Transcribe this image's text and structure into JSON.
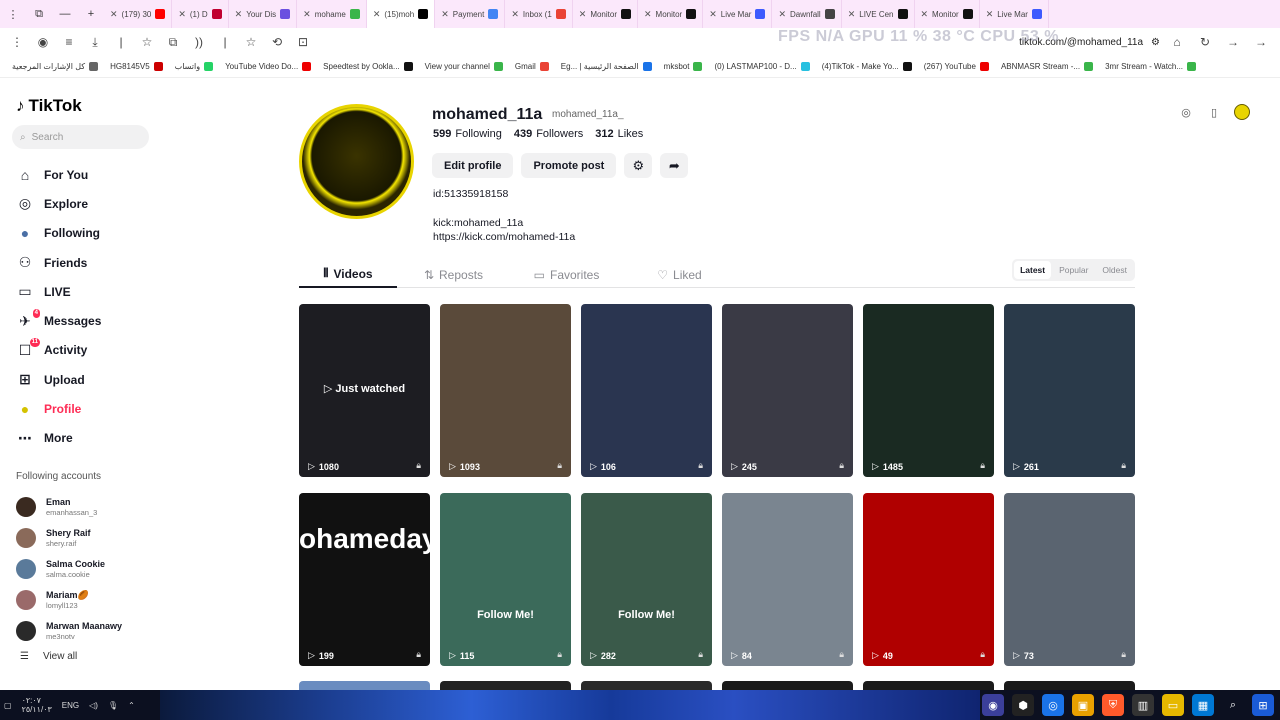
{
  "browser": {
    "tabs": [
      {
        "label": "(179) 30",
        "active": false,
        "fav_color": "#ff0000"
      },
      {
        "label": "(1) D",
        "active": false,
        "fav_color": "#c00030"
      },
      {
        "label": "Your Dis",
        "active": false,
        "fav_color": "#6b4fe0"
      },
      {
        "label": "mohame",
        "active": false,
        "fav_color": "#3ab54a"
      },
      {
        "label": "(15)moh",
        "active": true,
        "fav_color": "#000000"
      },
      {
        "label": "Payment",
        "active": false,
        "fav_color": "#4285f4"
      },
      {
        "label": "Inbox (1",
        "active": false,
        "fav_color": "#ea4335"
      },
      {
        "label": "Monitor",
        "active": false,
        "fav_color": "#111111"
      },
      {
        "label": "Monitor",
        "active": false,
        "fav_color": "#111111"
      },
      {
        "label": "Live Mar",
        "active": false,
        "fav_color": "#3d5afe"
      },
      {
        "label": "Dawnfall",
        "active": false,
        "fav_color": "#444444"
      },
      {
        "label": "LIVE Cen",
        "active": false,
        "fav_color": "#111111"
      },
      {
        "label": "Monitor",
        "active": false,
        "fav_color": "#111111"
      },
      {
        "label": "Live Mar",
        "active": false,
        "fav_color": "#3d5afe"
      }
    ],
    "address": "tiktok.com/@mohamed_11a",
    "overlay_text": "FPS  N/A     GPU  11 %  38 °C     CPU  53 %",
    "bookmarks": [
      {
        "label": "كل الإشارات المرجعية",
        "color": "#666"
      },
      {
        "label": "HG8145V5",
        "color": "#c00"
      },
      {
        "label": "واتساب",
        "color": "#25d366"
      },
      {
        "label": "YouTube Video Do...",
        "color": "#e00"
      },
      {
        "label": "Speedtest by Ookla...",
        "color": "#111"
      },
      {
        "label": "View your channel",
        "color": "#3ab54a"
      },
      {
        "label": "Gmail",
        "color": "#ea4335"
      },
      {
        "label": "Eg... | الصفحة الرئيسية",
        "color": "#1a73e8"
      },
      {
        "label": "mksbot",
        "color": "#3ab54a"
      },
      {
        "label": "(0) LASTMAP100 - D...",
        "color": "#27c0e0"
      },
      {
        "label": "(4)TikTok - Make Yo...",
        "color": "#111"
      },
      {
        "label": "(267) YouTube",
        "color": "#e00"
      },
      {
        "label": "ABNMASR Stream -...",
        "color": "#3ab54a"
      },
      {
        "label": "3mr Stream - Watch...",
        "color": "#3ab54a"
      }
    ]
  },
  "sidebar": {
    "logo": "TikTok",
    "search_placeholder": "Search",
    "nav": [
      {
        "label": "For You",
        "icon": "home-icon",
        "glyph": "⌂",
        "active": false,
        "badge": ""
      },
      {
        "label": "Explore",
        "icon": "compass-icon",
        "glyph": "◎",
        "active": false,
        "badge": ""
      },
      {
        "label": "Following",
        "icon": "following-avatar-icon",
        "glyph": "●",
        "active": false,
        "badge": ""
      },
      {
        "label": "Friends",
        "icon": "friends-icon",
        "glyph": "⚇",
        "active": false,
        "badge": ""
      },
      {
        "label": "LIVE",
        "icon": "live-icon",
        "glyph": "▭",
        "active": false,
        "badge": ""
      },
      {
        "label": "Messages",
        "icon": "messages-icon",
        "glyph": "✈",
        "active": false,
        "badge": "4"
      },
      {
        "label": "Activity",
        "icon": "activity-icon",
        "glyph": "☐",
        "active": false,
        "badge": "11"
      },
      {
        "label": "Upload",
        "icon": "upload-icon",
        "glyph": "⊞",
        "active": false,
        "badge": ""
      },
      {
        "label": "Profile",
        "icon": "profile-avatar-icon",
        "glyph": "●",
        "active": true,
        "badge": ""
      },
      {
        "label": "More",
        "icon": "more-icon",
        "glyph": "⋯",
        "active": false,
        "badge": ""
      }
    ],
    "following_title": "Following accounts",
    "following": [
      {
        "name": "Eman",
        "user": "emanhassan_3"
      },
      {
        "name": "Shery Raif",
        "user": "shery.raif"
      },
      {
        "name": "Salma Cookie",
        "user": "salma.cookie"
      },
      {
        "name": "Mariam🏉",
        "user": "lomyll123"
      },
      {
        "name": "Marwan Maanawy",
        "user": "me3notv"
      }
    ],
    "view_all": "View all"
  },
  "profile": {
    "username": "mohamed_11a",
    "nickname": "mohamed_11a_",
    "following_count": "599",
    "following_label": "Following",
    "followers_count": "439",
    "followers_label": "Followers",
    "likes_count": "312",
    "likes_label": "Likes",
    "edit_label": "Edit profile",
    "promote_label": "Promote post",
    "bio_id": "id:51335918158",
    "bio_line1": "kick:mohamed_11a",
    "bio_line2": "https://kick.com/mohamed-11a"
  },
  "tabs": [
    {
      "label": "Videos",
      "icon": "grid-icon",
      "active": true
    },
    {
      "label": "Reposts",
      "icon": "repost-icon",
      "active": false
    },
    {
      "label": "Favorites",
      "icon": "bookmark-icon",
      "active": false
    },
    {
      "label": "Liked",
      "icon": "heart-icon",
      "active": false
    }
  ],
  "sort": {
    "latest": "Latest",
    "popular": "Popular",
    "oldest": "Oldest"
  },
  "videos": [
    {
      "views": "1080",
      "overlay": "▷ Just watched",
      "bg": "#1d1d22"
    },
    {
      "views": "1093",
      "overlay": "",
      "bg": "#5a4a3a"
    },
    {
      "views": "106",
      "overlay": "",
      "bg": "#2a3550"
    },
    {
      "views": "245",
      "overlay": "",
      "bg": "#3a3a45"
    },
    {
      "views": "1485",
      "overlay": "",
      "bg": "#1a2a22"
    },
    {
      "views": "261",
      "overlay": "",
      "bg": "#2a3a4a"
    },
    {
      "views": "199",
      "overlay": "ohameday",
      "bg": "#111111"
    },
    {
      "views": "115",
      "overlay": "Follow Me!",
      "bg": "#3b6a5a"
    },
    {
      "views": "282",
      "overlay": "Follow Me!",
      "bg": "#3a5a4a"
    },
    {
      "views": "84",
      "overlay": "",
      "bg": "#7a8590"
    },
    {
      "views": "49",
      "overlay": "",
      "bg": "#b00000"
    },
    {
      "views": "73",
      "overlay": "",
      "bg": "#5a6470"
    }
  ],
  "taskbar": {
    "time": "٠٢:٠٧",
    "date": "٢٥/١١/٠٣",
    "lang": "ENG"
  }
}
